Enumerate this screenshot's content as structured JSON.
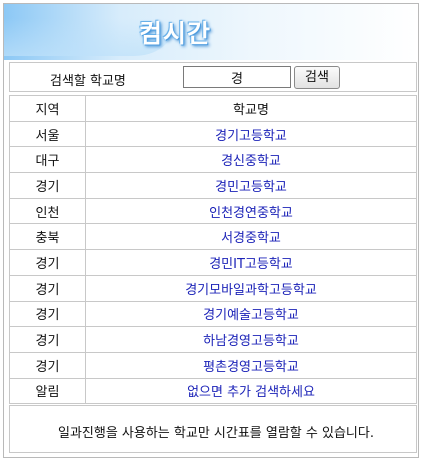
{
  "header": {
    "title": "컴시간"
  },
  "search": {
    "label": "검색할 학교명",
    "value": "경",
    "button_label": "검색"
  },
  "table": {
    "columns": [
      "지역",
      "학교명"
    ],
    "rows": [
      {
        "region": "서울",
        "school": "경기고등학교"
      },
      {
        "region": "대구",
        "school": "경신중학교"
      },
      {
        "region": "경기",
        "school": "경민고등학교"
      },
      {
        "region": "인천",
        "school": "인천경연중학교"
      },
      {
        "region": "충북",
        "school": "서경중학교"
      },
      {
        "region": "경기",
        "school": "경민IT고등학교"
      },
      {
        "region": "경기",
        "school": "경기모바일과학고등학교"
      },
      {
        "region": "경기",
        "school": "경기예술고등학교"
      },
      {
        "region": "경기",
        "school": "하남경영고등학교"
      },
      {
        "region": "경기",
        "school": "평촌경영고등학교"
      },
      {
        "region": "알림",
        "school": "없으면 추가 검색하세요"
      }
    ]
  },
  "notice": "일과진행을 사용하는 학교만 시간표를 열람할 수 있습니다.",
  "colors": {
    "link": "#1c23b8",
    "banner": "#8cc8f5",
    "border": "#c8c8c8"
  }
}
